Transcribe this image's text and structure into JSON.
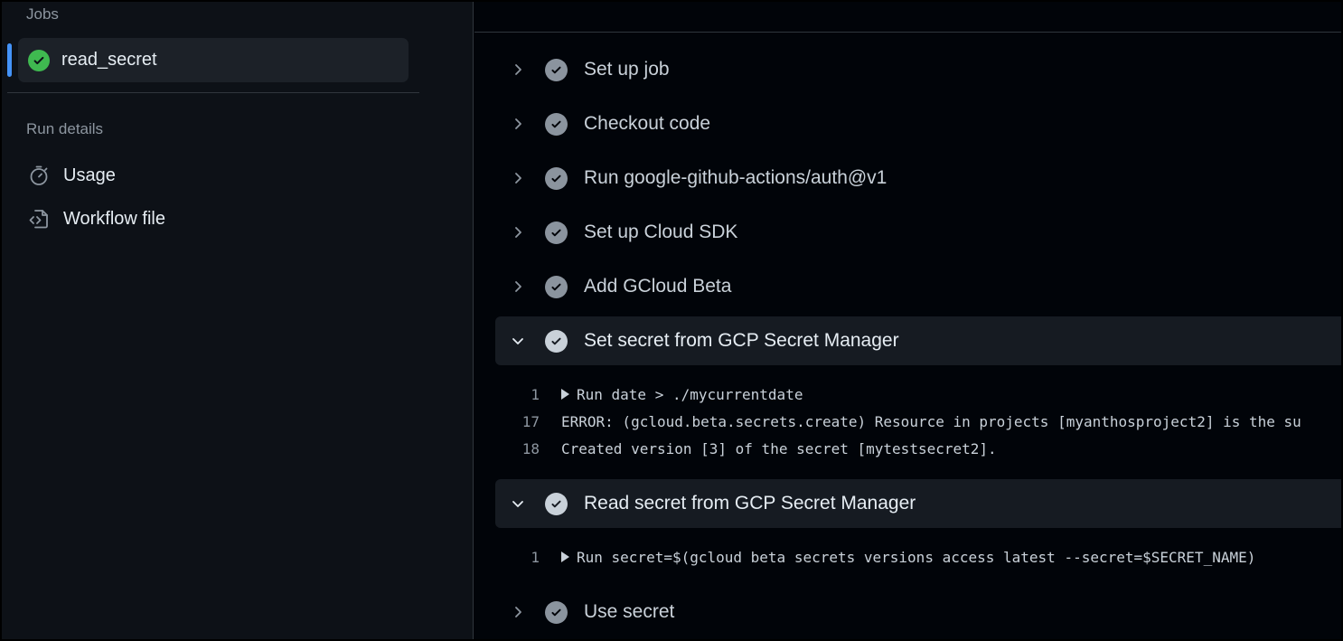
{
  "sidebar": {
    "jobs_heading": "Jobs",
    "job": {
      "label": "read_secret",
      "status": "success"
    },
    "run_details_heading": "Run details",
    "nav": [
      {
        "label": "Usage",
        "icon": "stopwatch-icon"
      },
      {
        "label": "Workflow file",
        "icon": "file-code-icon"
      }
    ]
  },
  "steps": [
    {
      "name": "Set up job",
      "expanded": false
    },
    {
      "name": "Checkout code",
      "expanded": false
    },
    {
      "name": "Run google-github-actions/auth@v1",
      "expanded": false
    },
    {
      "name": "Set up Cloud SDK",
      "expanded": false
    },
    {
      "name": "Add GCloud Beta",
      "expanded": false
    },
    {
      "name": "Set secret from GCP Secret Manager",
      "expanded": true,
      "logs": [
        {
          "num": "1",
          "text": "Run date > ./mycurrentdate",
          "collapsible": true
        },
        {
          "num": "17",
          "text": "ERROR: (gcloud.beta.secrets.create) Resource in projects [myanthosproject2] is the su",
          "collapsible": false
        },
        {
          "num": "18",
          "text": "Created version [3] of the secret [mytestsecret2].",
          "collapsible": false
        }
      ]
    },
    {
      "name": "Read secret from GCP Secret Manager",
      "expanded": true,
      "logs": [
        {
          "num": "1",
          "text": "Run secret=$(gcloud beta secrets versions access latest --secret=$SECRET_NAME)",
          "collapsible": true
        }
      ]
    },
    {
      "name": "Use secret",
      "expanded": false
    }
  ],
  "colors": {
    "success": "#3fb950",
    "accent": "#4493f8",
    "background": "#010409",
    "sidebar_bg": "#0d1117"
  }
}
